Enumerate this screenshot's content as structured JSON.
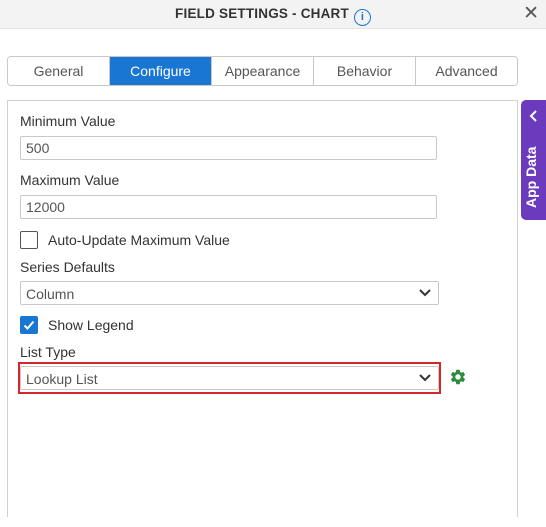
{
  "header": {
    "title": "FIELD SETTINGS - CHART",
    "info_icon": "i",
    "close_icon": "✕"
  },
  "tabs": [
    {
      "label": "General",
      "active": false
    },
    {
      "label": "Configure",
      "active": true
    },
    {
      "label": "Appearance",
      "active": false
    },
    {
      "label": "Behavior",
      "active": false
    },
    {
      "label": "Advanced",
      "active": false
    }
  ],
  "form": {
    "minimum": {
      "label": "Minimum Value",
      "value": "500"
    },
    "maximum": {
      "label": "Maximum Value",
      "value": "12000"
    },
    "auto_update": {
      "label": "Auto-Update Maximum Value",
      "checked": false
    },
    "series_defaults": {
      "label": "Series Defaults",
      "value": "Column"
    },
    "show_legend": {
      "label": "Show Legend",
      "checked": true
    },
    "list_type": {
      "label": "List Type",
      "value": "Lookup List"
    }
  },
  "side_panel": {
    "label": "App Data"
  },
  "colors": {
    "accent": "#1976d2",
    "side_tab": "#6c3bbd",
    "highlight": "#d6262d",
    "gear": "#2e8b3a"
  }
}
